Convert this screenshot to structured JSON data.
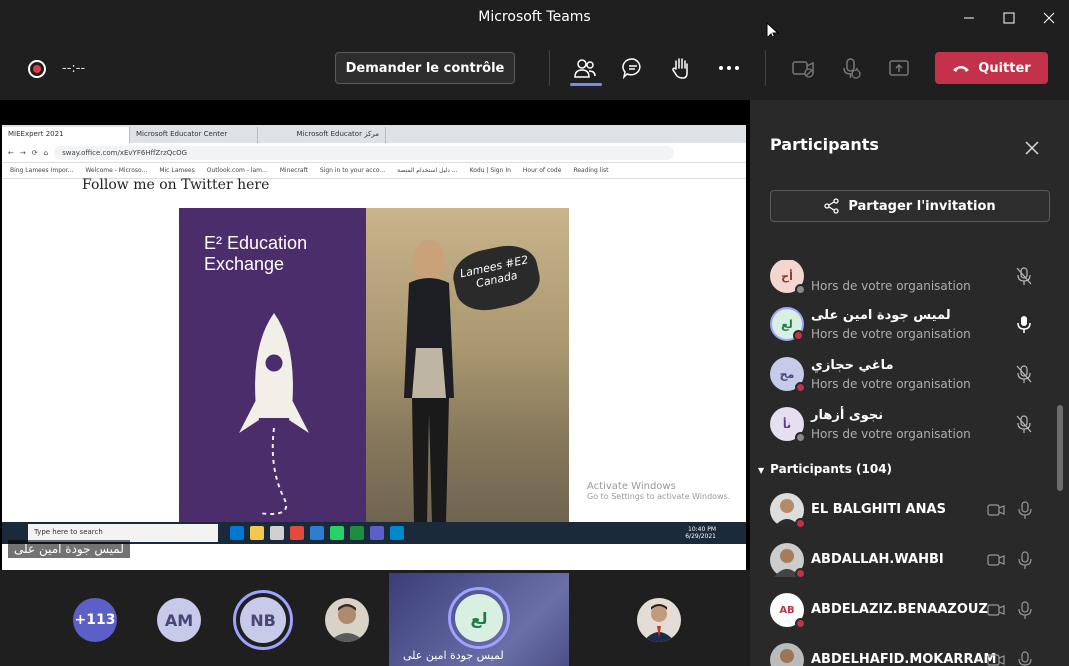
{
  "window": {
    "title": "Microsoft Teams"
  },
  "toolbar": {
    "timer": "--:--",
    "control_label": "Demander le contrôle",
    "quit_label": "Quitter"
  },
  "shared_screen": {
    "tabs": [
      "MIEExpert 2021",
      "Microsoft Educator Center",
      "Microsoft Educator مركز"
    ],
    "url": "sway.office.com/xEvYF6HffZrzQcOG",
    "bookmarks": [
      "Bing Lamees Impor...",
      "Welcome - Microso...",
      "Mic Lamees",
      "Outlook.com - lam...",
      "Minecraft",
      "Sign in to your acco...",
      "دليل استخدام المنصة ...",
      "Kodu | Sign In",
      "Hour of code",
      "Reading list"
    ],
    "follow_text": "Follow me on Twitter here",
    "banner_text": "Education Exchange",
    "banner_logo": "E²",
    "sign_text": "Lamees #E2 Canada",
    "watermark_title": "Activate Windows",
    "watermark_sub": "Go to Settings to activate Windows.",
    "taskbar_search": "Type here to search",
    "clock_time": "10:40 PM",
    "clock_date": "6/29/2021",
    "lang": "ENG",
    "presenter_name": "لميس جودة امين على"
  },
  "strip": {
    "more_count": "+113",
    "am_initials": "AM",
    "nb_initials": "NB",
    "speaker_initials": "لع",
    "speaker_name": "لميس جودة امين على"
  },
  "panel": {
    "title": "Participants",
    "invite_label": "Partager l'invitation",
    "org_label": "Hors de votre organisation",
    "section_label": "Participants (104)",
    "top_rows": [
      {
        "initials": "أح",
        "name": "",
        "org": "Hors de votre organisation",
        "mic": "muted"
      },
      {
        "initials": "لع",
        "name": "لميس جودة امين على",
        "org": "Hors de votre organisation",
        "mic": "on"
      },
      {
        "initials": "مح",
        "name": "ماغي حجازي",
        "org": "Hors de votre organisation",
        "mic": "muted"
      },
      {
        "initials": "نأ",
        "name": "نجوى أزهار",
        "org": "Hors de votre organisation",
        "mic": "muted"
      }
    ],
    "list_rows": [
      {
        "name": "EL BALGHITI ANAS"
      },
      {
        "name": "ABDALLAH.WAHBI"
      },
      {
        "name": "ABDELAZIZ.BENAAZOUZ",
        "initials": "AB"
      },
      {
        "name": "ABDELHAFID.MOKARRAM"
      }
    ]
  },
  "colors": {
    "accent": "#7f85f5",
    "quit": "#c4314b",
    "panel_bg": "#292929",
    "app_bg": "#1f1f1f"
  }
}
